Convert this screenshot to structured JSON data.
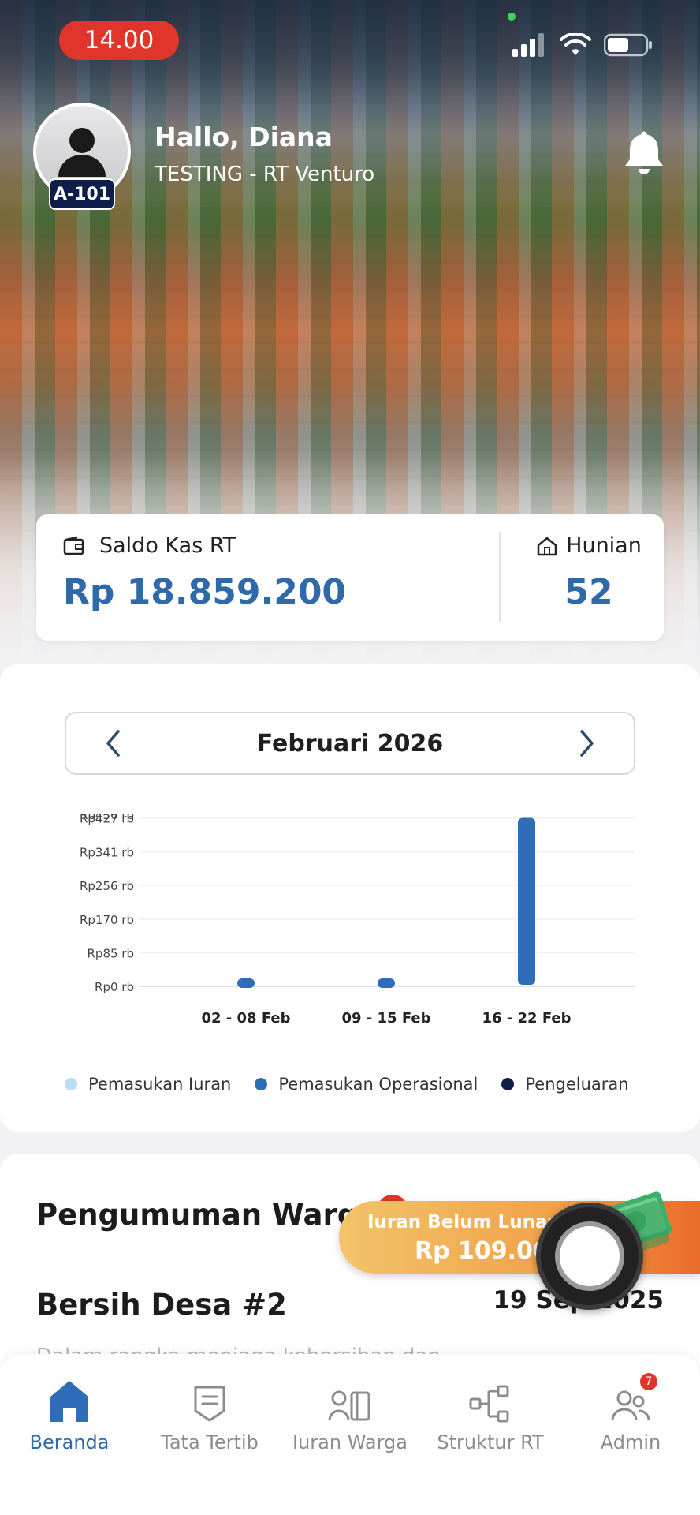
{
  "status_bar": {
    "time": "14.00"
  },
  "profile": {
    "greeting": "Hallo, Diana",
    "subtitle": "TESTING - RT Venturo",
    "unit": "A-101"
  },
  "saldo": {
    "label": "Saldo Kas RT",
    "amount": "Rp 18.859.200",
    "hunian_label": "Hunian",
    "hunian_count": "52"
  },
  "chart_section": {
    "month": "Februari 2026"
  },
  "chart_data": {
    "type": "bar",
    "categories": [
      "02 - 08 Feb",
      "09 - 15 Feb",
      "16 - 22 Feb"
    ],
    "y_ticks": [
      "Rp0 rb",
      "Rp85 rb",
      "Rp170 rb",
      "Rp256 rb",
      "Rp341 rb",
      "Rp427 rb",
      "Rp436 rb"
    ],
    "ylim": [
      0,
      436000
    ],
    "series": [
      {
        "name": "Pemasukan Iuran",
        "color": "#b9dcf7",
        "values": [
          0,
          0,
          0
        ]
      },
      {
        "name": "Pemasukan Operasional",
        "color": "#2f6db8",
        "values": [
          20000,
          20000,
          427000
        ]
      },
      {
        "name": "Pengeluaran",
        "color": "#0f1d4a",
        "values": [
          0,
          0,
          0
        ]
      }
    ],
    "grid": true,
    "legend_position": "bottom"
  },
  "announcements": {
    "title": "Pengumuman Warga",
    "event_title": "Bersih Desa #2",
    "event_date": "19 Sep 2025",
    "event_desc": "Dalam rangka menjaga kebersihan dan"
  },
  "iuran_banner": {
    "label": "Iuran Belum Lunas",
    "amount": "Rp 109.000"
  },
  "bottom_nav": {
    "items": [
      {
        "label": "Beranda",
        "icon": "home-icon"
      },
      {
        "label": "Tata Tertib",
        "icon": "rules-icon"
      },
      {
        "label": "Iuran Warga",
        "icon": "payment-icon"
      },
      {
        "label": "Struktur RT",
        "icon": "org-structure-icon"
      },
      {
        "label": "Admin",
        "icon": "admin-icon",
        "badge": "7"
      }
    ]
  },
  "colors": {
    "accent": "#2f6aa8",
    "danger": "#e0352b",
    "navy": "#0f1d4a"
  }
}
